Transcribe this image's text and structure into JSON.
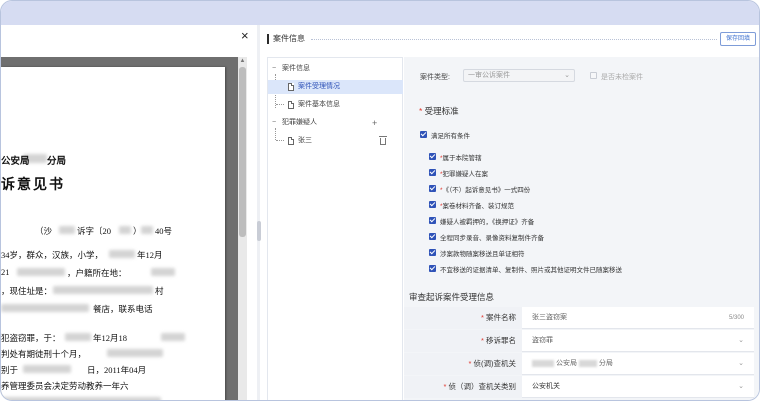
{
  "viewer": {
    "close_glyph": "×",
    "doc_lines": [
      "公安局",
      "分局",
      "诉意见书",
      "（沙",
      "诉字〔20",
      "）",
      "40号",
      "34岁，群众，汉族，小学，",
      "年12月",
      "21",
      "，户籍所在地：",
      "，现住址是：",
      "村",
      "餐店，联系电话",
      "犯盗窃罪，于：",
      "年12月18",
      "判处有期徒刑十个月，",
      "别于",
      "日，2011年04月",
      "养管理委员会决定劳动教养一年六"
    ]
  },
  "panel": {
    "title": "案件信息",
    "save_label": "保存回填"
  },
  "tree": {
    "root_label": "案件信息",
    "items": [
      "案件受理情况",
      "案件基本信息"
    ],
    "suspect_group_label": "犯罪嫌疑人",
    "suspect_name": "张三"
  },
  "form": {
    "case_type_label": "案件类型:",
    "case_type_value": "一审公诉案件",
    "not_detected_label": "是否未检案件",
    "accept_standard_title": "受理标准",
    "satisfy_all_label": "满足所有条件",
    "conditions": [
      "属于本院管辖",
      "犯罪嫌疑人在案",
      "《（不）起诉意见书》一式四份",
      "案卷材料齐备、装订规范",
      "嫌疑人被羁押的，《换押证》齐备",
      "全程同步录音、录像资料复制件齐备",
      "涉案款物随案移送且单证相符",
      "不宜移送的证据清单、复制件、照片或其他证明文件已随案移送"
    ],
    "review_title": "审查起诉案件受理信息",
    "rows": [
      {
        "label": "案件名称",
        "value": "张三盗窃案",
        "count": "5/300"
      },
      {
        "label": "移诉罪名",
        "value": "盗窃罪"
      },
      {
        "label": "侦(调)查机关",
        "value": "公安局",
        "value2": "分局"
      },
      {
        "label": "侦（调）查机关类别",
        "value": "公安机关"
      }
    ]
  }
}
